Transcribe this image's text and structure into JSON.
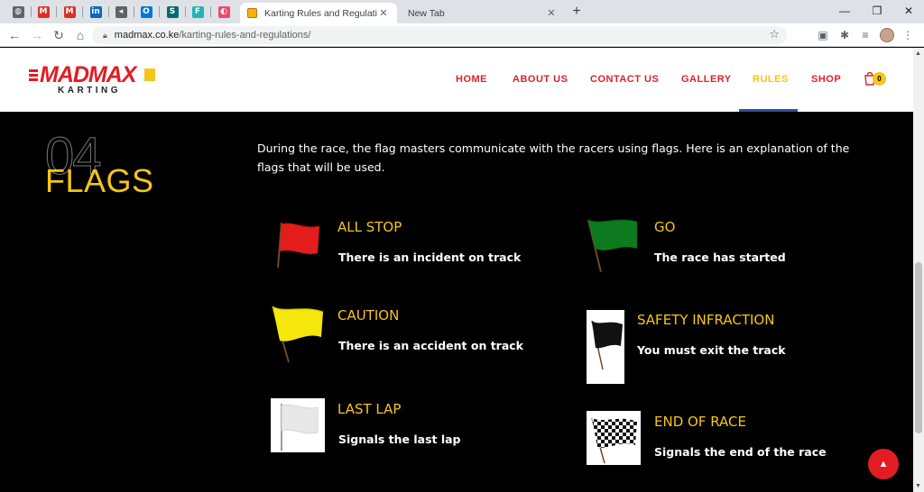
{
  "browser": {
    "pinned_tabs": [
      {
        "icon": "globe-icon",
        "glyph": "◍",
        "color": "#5f6368"
      },
      {
        "icon": "gmail-icon",
        "glyph": "M",
        "color": "#d93025"
      },
      {
        "icon": "gmail-icon",
        "glyph": "M",
        "color": "#d93025"
      },
      {
        "icon": "linkedin-icon",
        "glyph": "in",
        "color": "#0a66c2"
      },
      {
        "icon": "audio-icon",
        "glyph": "◂",
        "color": "#5f6368"
      },
      {
        "icon": "outlook-icon",
        "glyph": "O",
        "color": "#0078d4"
      },
      {
        "icon": "sharepoint-icon",
        "glyph": "S",
        "color": "#036c70"
      },
      {
        "icon": "f-icon",
        "glyph": "F",
        "color": "#1fb5b5"
      },
      {
        "icon": "ball-icon",
        "glyph": "◐",
        "color": "#e94a6f"
      }
    ],
    "active_tab_title": "Karting Rules and Regulations - M",
    "new_tab_title": "New Tab",
    "url_host": "madmax.co.ke",
    "url_path": "/karting-rules-and-regulations/"
  },
  "site": {
    "logo_word": "MADMAX",
    "logo_sub": "KARTING",
    "nav": [
      "HOME",
      "ABOUT US",
      "CONTACT US",
      "GALLERY",
      "RULES",
      "SHOP"
    ],
    "cart_count": "0"
  },
  "content": {
    "section_number": "04",
    "section_title": "FLAGS",
    "intro": "During the race, the flag masters communicate with the racers using flags. Here is an explanation of the flags that will be used.",
    "flags": [
      {
        "title": "ALL STOP",
        "desc": "There is an incident on track",
        "color": "#e31c1c",
        "icon": "red-flag-icon"
      },
      {
        "title": "GO",
        "desc": "The race has started",
        "color": "#0d7a1f",
        "icon": "green-flag-icon"
      },
      {
        "title": "CAUTION",
        "desc": "There is an accident on track",
        "color": "#f5e60c",
        "icon": "yellow-flag-icon"
      },
      {
        "title": "SAFETY INFRACTION",
        "desc": "You must exit the track",
        "color": "#111111",
        "icon": "black-flag-icon"
      },
      {
        "title": "LAST LAP",
        "desc": "Signals the last lap",
        "color": "#f0f0f0",
        "icon": "white-flag-icon"
      },
      {
        "title": "END OF RACE",
        "desc": "Signals the end of the race",
        "color": "#111111",
        "icon": "checkered-flag-icon"
      }
    ]
  },
  "colors": {
    "brand_red": "#e31c23",
    "brand_yellow": "#f5c518",
    "active_underline": "#2f4f9e"
  }
}
